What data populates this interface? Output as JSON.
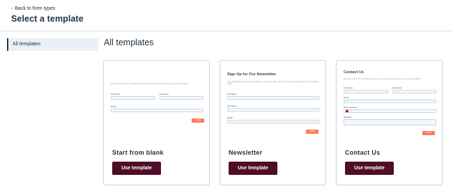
{
  "header": {
    "back_label": "Back to form types",
    "title": "Select a template"
  },
  "sidebar": {
    "items": [
      {
        "label": "All templates"
      }
    ]
  },
  "main": {
    "title": "All templates"
  },
  "cards": [
    {
      "name": "Start from blank",
      "button": "Use template",
      "preview": {
        "intro": "We'd love to hear from you! Please fill out the form and we'll get back to you as soon as possible.",
        "first_name": "First Name",
        "last_name": "Last Name",
        "email": "Email*",
        "submit": "Submit"
      }
    },
    {
      "name": "Newsletter",
      "button": "Use template",
      "preview": {
        "title": "Sign Up for Our Newsletter",
        "intro": "Stay updated with the latest news, updates, and special offers. Join our community by signing up for our newsletter today!",
        "first_name": "First Name",
        "last_name": "Last Name",
        "email": "Email*",
        "submit": "Submit"
      }
    },
    {
      "name": "Contact Us",
      "button": "Use template",
      "preview": {
        "title": "Contact Us",
        "intro": "We'd love to hear from you! Please fill out the form and we'll get back to you as soon as possible.",
        "first_name": "First Name",
        "last_name": "Last Name",
        "email": "Email",
        "phone": "Phone Number",
        "phone_code": "+1",
        "message": "Message",
        "submit": "Submit"
      }
    }
  ]
}
